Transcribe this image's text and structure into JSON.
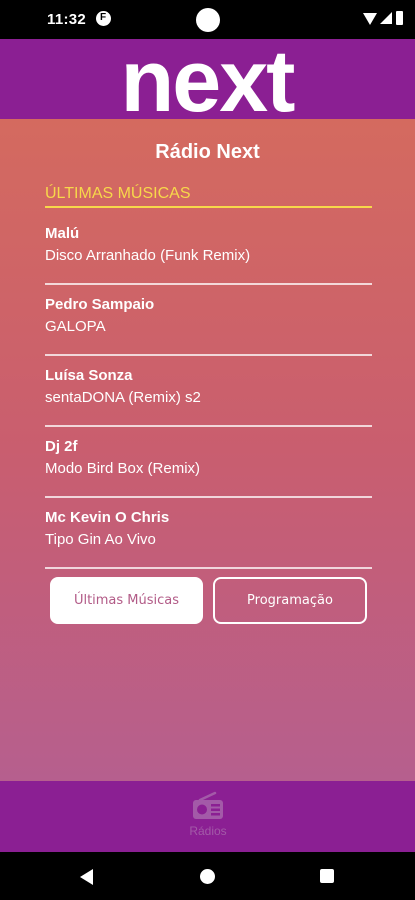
{
  "status_bar": {
    "time": "11:32",
    "app_icon": "app-notification-icon"
  },
  "header": {
    "logo_text": "next",
    "logo_color": "#ffffff",
    "background": "#8b1f93"
  },
  "page": {
    "title": "Rádio Next"
  },
  "section": {
    "title": "ÚLTIMAS MÚSICAS",
    "accent_color": "#f7d84a"
  },
  "songs": [
    {
      "artist": "Malú",
      "title": "Disco Arranhado (Funk Remix)"
    },
    {
      "artist": "Pedro Sampaio",
      "title": "GALOPA"
    },
    {
      "artist": "Luísa Sonza",
      "title": "sentaDONA (Remix) s2"
    },
    {
      "artist": "Dj 2f",
      "title": "Modo Bird Box (Remix)"
    },
    {
      "artist": "Mc Kevin O Chris",
      "title": "Tipo Gin Ao Vivo"
    }
  ],
  "buttons": {
    "recent": "Últimas Músicas",
    "schedule": "Programação"
  },
  "bottom_nav": {
    "radios_label": "Rádios",
    "radios_icon": "radio-icon"
  }
}
